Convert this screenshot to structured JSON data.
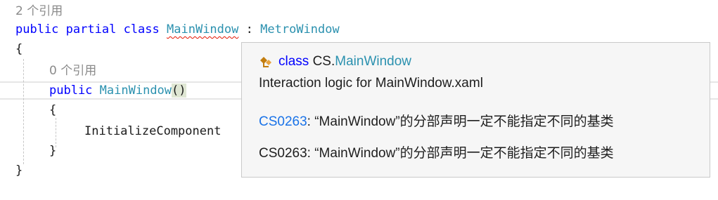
{
  "editor": {
    "class_refs": "2 个引用",
    "kw_public": "public",
    "kw_partial": "partial",
    "kw_class": "class",
    "class_name": "MainWindow",
    "colon": ":",
    "base_class": "MetroWindow",
    "open_brace": "{",
    "ctor_refs": "0 个引用",
    "ctor_public": "public",
    "ctor_name": "MainWindow",
    "ctor_parens": "()",
    "ctor_open_brace": "{",
    "call_text": "InitializeComponent",
    "ctor_close_brace": "}",
    "close_brace": "}"
  },
  "tooltip": {
    "icon": "class-icon",
    "kind_keyword": "class",
    "namespace": "CS.",
    "type_name": "MainWindow",
    "summary": "Interaction logic for MainWindow.xaml",
    "error1_code": "CS0263",
    "error1_message": ": “MainWindow”的分部声明一定不能指定不同的基类",
    "error2_text": "CS0263: “MainWindow”的分部声明一定不能指定不同的基类"
  },
  "colors": {
    "keyword": "#0000ff",
    "type": "#2b91af",
    "error_squiggle": "#e51400",
    "link": "#1a73e8"
  }
}
